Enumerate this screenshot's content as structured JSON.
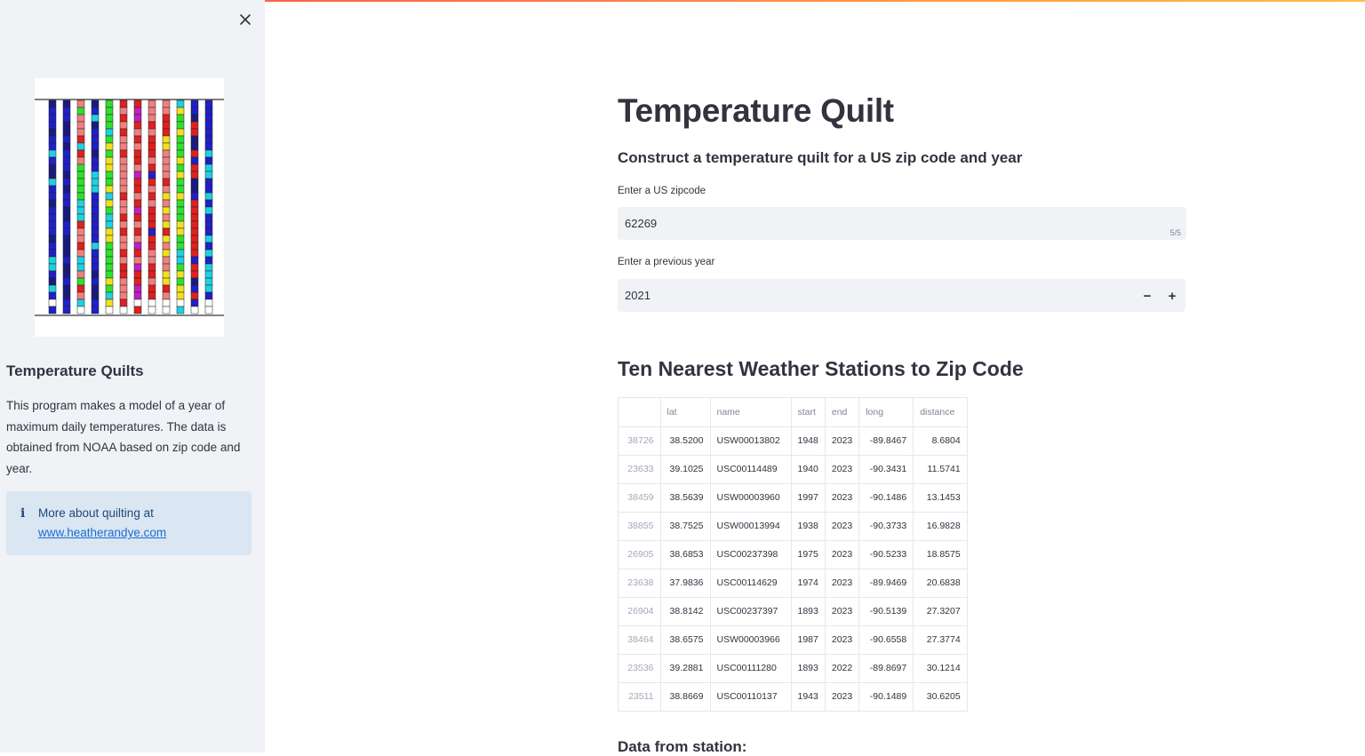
{
  "sidebar": {
    "heading": "Temperature Quilts",
    "description": "This program makes a model of a year of maximum daily temperatures. The data is obtained from NOAA based on zip code and year.",
    "info_text": "More about quilting at",
    "info_link": "www.heatherandye.com",
    "close_icon": "close-icon",
    "info_icon": "info-icon",
    "quilt_colors": [
      "#2020c8",
      "#1a1a80",
      "#20d0e0",
      "#30e030",
      "#f0e020",
      "#e02020",
      "#f08080",
      "#c020c0",
      "#ffffff"
    ]
  },
  "main": {
    "title": "Temperature Quilt",
    "subtitle": "Construct a temperature quilt for a US zip code and year",
    "zip_label": "Enter a US zipcode",
    "zip_value": "62269",
    "zip_count": "5/5",
    "year_label": "Enter a previous year",
    "year_value": "2021",
    "minus_label": "−",
    "plus_label": "+",
    "stations_title": "Ten Nearest Weather Stations to Zip Code",
    "data_title": "Data from station:"
  },
  "table": {
    "columns": [
      "",
      "lat",
      "name",
      "start",
      "end",
      "long",
      "distance"
    ],
    "rows": [
      [
        "38726",
        "38.5200",
        "USW00013802",
        "1948",
        "2023",
        "-89.8467",
        "8.6804"
      ],
      [
        "23633",
        "39.1025",
        "USC00114489",
        "1940",
        "2023",
        "-90.3431",
        "11.5741"
      ],
      [
        "38459",
        "38.5639",
        "USW00003960",
        "1997",
        "2023",
        "-90.1486",
        "13.1453"
      ],
      [
        "38855",
        "38.7525",
        "USW00013994",
        "1938",
        "2023",
        "-90.3733",
        "16.9828"
      ],
      [
        "26905",
        "38.6853",
        "USC00237398",
        "1975",
        "2023",
        "-90.5233",
        "18.8575"
      ],
      [
        "23638",
        "37.9836",
        "USC00114629",
        "1974",
        "2023",
        "-89.9469",
        "20.6838"
      ],
      [
        "26904",
        "38.8142",
        "USC00237397",
        "1893",
        "2023",
        "-90.5139",
        "27.3207"
      ],
      [
        "38464",
        "38.6575",
        "USW00003966",
        "1987",
        "2023",
        "-90.6558",
        "27.3774"
      ],
      [
        "23536",
        "39.2881",
        "USC00111280",
        "1893",
        "2022",
        "-89.8697",
        "30.1214"
      ],
      [
        "23511",
        "38.8669",
        "USC00110137",
        "1943",
        "2023",
        "-90.1489",
        "30.6205"
      ]
    ]
  }
}
